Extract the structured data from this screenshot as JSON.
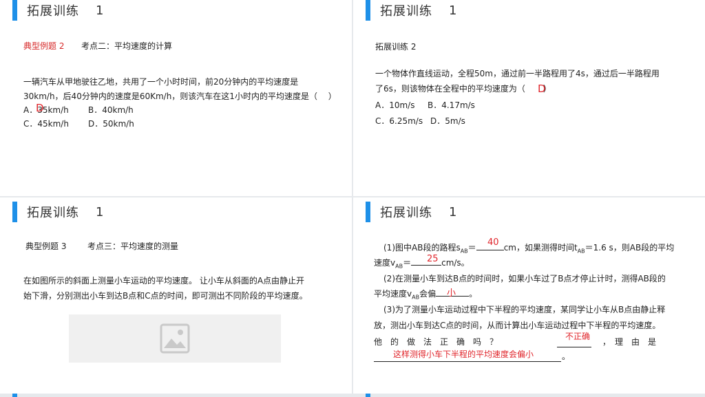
{
  "slide1": {
    "header": {
      "title": "拓展训练",
      "num": "1"
    },
    "example": "典型例题 2",
    "topic": "考点二：平均速度的计算",
    "q1": "一辆汽车从甲地驶往乙地，共用了一个小时时间，前20分钟内的平均速度是",
    "q2": "30km/h，后40分钟内的速度是60Km/h，则该汽车在这1小时内的平均速度是（　 ）",
    "optA": "A．35km/h",
    "optB": "B．40km/h",
    "optC": "C．45km/h",
    "optD": "D．50km/h",
    "answer": "D"
  },
  "slide2": {
    "header": {
      "title": "拓展训练",
      "num": "1"
    },
    "subtitle": "拓展训练 2",
    "q1": "一个物体作直线运动，全程50m，通过前一半路程用了4s，通过后一半路程用",
    "q2a": "了6s，则该物体在全程中的平均速度为（",
    "q2b": "）",
    "optA": "A．10m/s",
    "optB": "B．4.17m/s",
    "optC": "C．6.25m/s",
    "optD": "D．5m/s",
    "answer": "D"
  },
  "slide3": {
    "header": {
      "title": "拓展训练",
      "num": "1"
    },
    "example": "典型例题 3",
    "topic": "考点三：平均速度的测量",
    "p1": "在如图所示的斜面上测量小车运动的平均速度。 让小车从斜面的A点由静止开",
    "p2": "始下滑，分别测出小车到达B点和C点的时间，即可测出不同阶段的平均速度。"
  },
  "slide4": {
    "header": {
      "title": "拓展训练",
      "num": "1"
    },
    "l1a": "(1)图中AB段的路程s",
    "l1sub": "AB",
    "l1b": "＝",
    "l1c": "cm，如果测得时间t",
    "l1sub2": "AB",
    "l1d": "＝1.6 s，则AB段的平均",
    "l2a": "速度v",
    "l2sub": "AB",
    "l2b": "＝",
    "l2c": "cm/s。",
    "l3": "(2)在测量小车到达B点的时间时，如果小车过了B点才停止计时，测得AB段的",
    "l4a": "平均速度v",
    "l4sub": "AB",
    "l4b": "会偏",
    "l4c": "。",
    "l5": "(3)为了测量小车运动过程中下半程的平均速度，某同学让小车从B点由静止释",
    "l6": "放，测出小车到达C点的时间，从而计算出小车运动过程中下半程的平均速度。",
    "l7a": "他　的　做　法　正　确　吗　？",
    "l7b": "，　理　由　是",
    "l8end": "。",
    "ans1": "40",
    "ans2": "25",
    "ans3": "小",
    "ans4": "不正确",
    "ans5": "这样测得小车下半程的平均速度会偏小"
  }
}
